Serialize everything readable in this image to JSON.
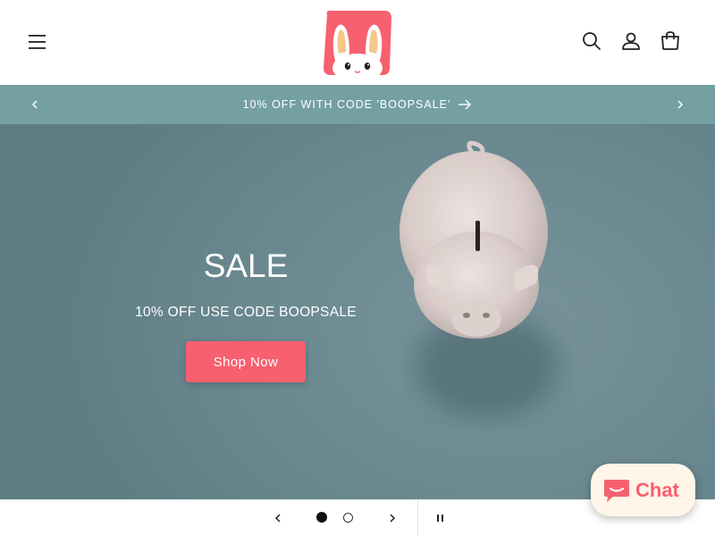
{
  "header": {
    "menu_icon": "hamburger-menu-icon",
    "logo_icon": "bunny-logo-icon",
    "search_icon": "search-icon",
    "account_icon": "user-account-icon",
    "cart_icon": "shopping-bag-icon"
  },
  "announcement": {
    "text": "10% OFF WITH CODE 'BOOPSALE'",
    "background": "#74a0a2"
  },
  "hero": {
    "title": "SALE",
    "subtitle": "10% OFF USE CODE BOOPSALE",
    "button_label": "Shop Now",
    "button_color": "#f7606f",
    "image_subject": "piggy-bank"
  },
  "slideshow": {
    "slides": 2,
    "active_slide": 1,
    "pause_icon": "pause-icon"
  },
  "chat": {
    "label": "Chat",
    "icon": "chat-bubble-icon",
    "accent": "#f7606f"
  }
}
